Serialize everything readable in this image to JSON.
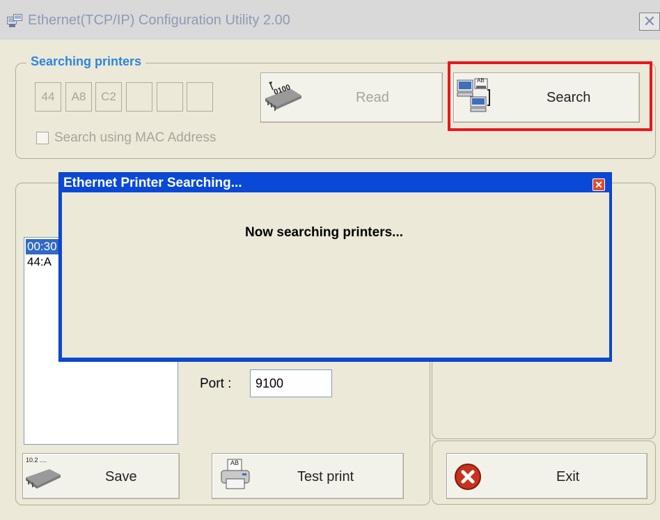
{
  "window": {
    "title": "Ethernet(TCP/IP) Configuration Utility 2.00",
    "close_glyph": "✕"
  },
  "search_group": {
    "label": "Searching printers",
    "mac_octets": [
      "44",
      "A8",
      "C2",
      "",
      "",
      ""
    ],
    "read_button_label": "Read",
    "read_icon_text": "0100",
    "search_button_label": "Search",
    "search_icon_text": "AB",
    "mac_checkbox_label": "Search using MAC Address",
    "mac_checkbox_checked": false
  },
  "printer_list": {
    "items": [
      {
        "text": "00:30",
        "selected": true
      },
      {
        "text": "44:A",
        "selected": false
      }
    ]
  },
  "settings": {
    "port_label": "Port :",
    "port_value": "9100"
  },
  "bottom_buttons": {
    "save_label": "Save",
    "save_icon_text": "10.2 ....",
    "test_print_label": "Test print",
    "test_print_icon_text": "AB",
    "exit_label": "Exit"
  },
  "dialog": {
    "title": "Ethernet Printer Searching...",
    "message": "Now searching printers...",
    "close_glyph": "✕"
  },
  "colors": {
    "group_label": "#2c84e0",
    "dialog_titlebar": "#0a49d8",
    "highlight_box": "#e8171c",
    "list_selection": "#316ac5",
    "exit_icon": "#c8321e"
  }
}
